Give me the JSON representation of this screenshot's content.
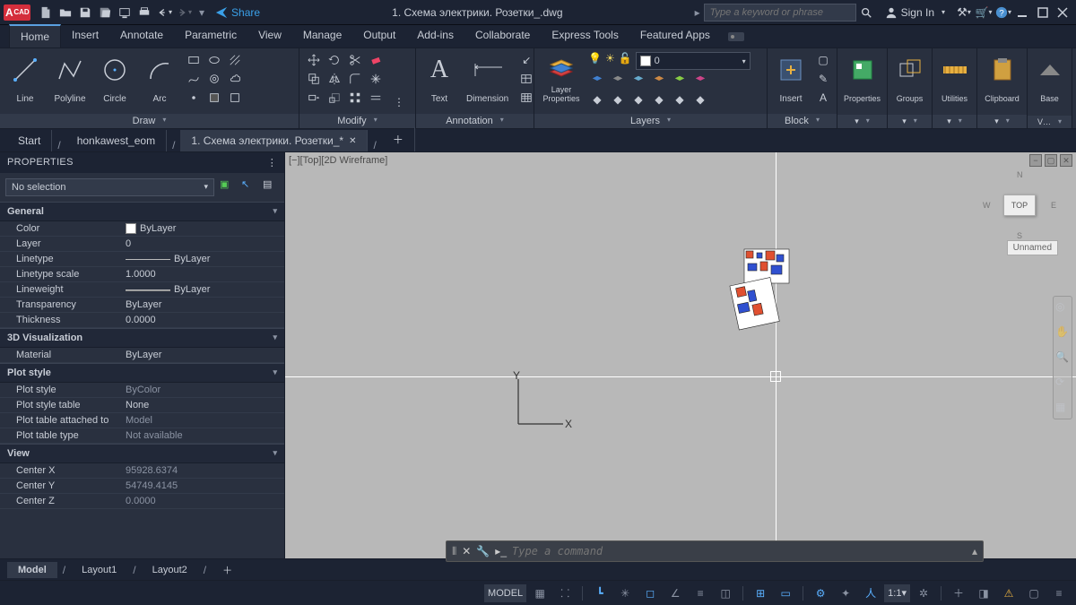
{
  "app": {
    "badge": "CAD",
    "doc_title": "1. Схема электрики. Розетки_.dwg",
    "search_placeholder": "Type a keyword or phrase",
    "signin": "Sign In",
    "share": "Share"
  },
  "tabs": [
    "Home",
    "Insert",
    "Annotate",
    "Parametric",
    "View",
    "Manage",
    "Output",
    "Add-ins",
    "Collaborate",
    "Express Tools",
    "Featured Apps"
  ],
  "ribbon": {
    "draw": {
      "label": "Draw",
      "items": [
        "Line",
        "Polyline",
        "Circle",
        "Arc"
      ]
    },
    "modify": {
      "label": "Modify"
    },
    "annotation": {
      "label": "Annotation",
      "text": "Text",
      "dim": "Dimension"
    },
    "layers": {
      "label": "Layers",
      "panel_title": "Layer Properties",
      "current": "0"
    },
    "block": {
      "label": "Block",
      "insert": "Insert"
    },
    "properties": {
      "label": "Properties"
    },
    "groups": {
      "label": "Groups"
    },
    "utilities": {
      "label": "Utilities"
    },
    "clipboard": {
      "label": "Clipboard"
    },
    "view": {
      "label": "V…",
      "base": "Base"
    }
  },
  "filetabs": [
    {
      "label": "Start",
      "active": false,
      "close": false
    },
    {
      "label": "honkawest_eom",
      "active": false,
      "close": false
    },
    {
      "label": "1. Схема электрики. Розетки_*",
      "active": true,
      "close": true
    }
  ],
  "properties": {
    "title": "PROPERTIES",
    "selection": "No selection",
    "general": {
      "title": "General",
      "rows": [
        {
          "k": "Color",
          "v": "ByLayer",
          "swatch": true
        },
        {
          "k": "Layer",
          "v": "0"
        },
        {
          "k": "Linetype",
          "v": "ByLayer",
          "line": true
        },
        {
          "k": "Linetype scale",
          "v": "1.0000"
        },
        {
          "k": "Lineweight",
          "v": "ByLayer",
          "weight": true
        },
        {
          "k": "Transparency",
          "v": "ByLayer"
        },
        {
          "k": "Thickness",
          "v": "0.0000"
        }
      ]
    },
    "viz": {
      "title": "3D Visualization",
      "rows": [
        {
          "k": "Material",
          "v": "ByLayer"
        }
      ]
    },
    "plot": {
      "title": "Plot style",
      "rows": [
        {
          "k": "Plot style",
          "v": "ByColor",
          "dim": true
        },
        {
          "k": "Plot style table",
          "v": "None"
        },
        {
          "k": "Plot table attached to",
          "v": "Model",
          "dim": true
        },
        {
          "k": "Plot table type",
          "v": "Not available",
          "dim": true
        }
      ]
    },
    "viewcat": {
      "title": "View",
      "rows": [
        {
          "k": "Center X",
          "v": "95928.6374",
          "dim": true
        },
        {
          "k": "Center Y",
          "v": "54749.4145",
          "dim": true
        },
        {
          "k": "Center Z",
          "v": "0.0000",
          "dim": true
        }
      ]
    }
  },
  "canvas": {
    "view_label": "[−][Top][2D Wireframe]",
    "ucs": {
      "x": "X",
      "y": "Y"
    },
    "viewcube": {
      "face": "TOP",
      "n": "N",
      "s": "S",
      "e": "E",
      "w": "W",
      "wcs": "Unnamed"
    }
  },
  "command": {
    "placeholder": "Type a command"
  },
  "layouts": [
    "Model",
    "Layout1",
    "Layout2"
  ],
  "status": {
    "model": "MODEL",
    "scale": "1:1"
  }
}
